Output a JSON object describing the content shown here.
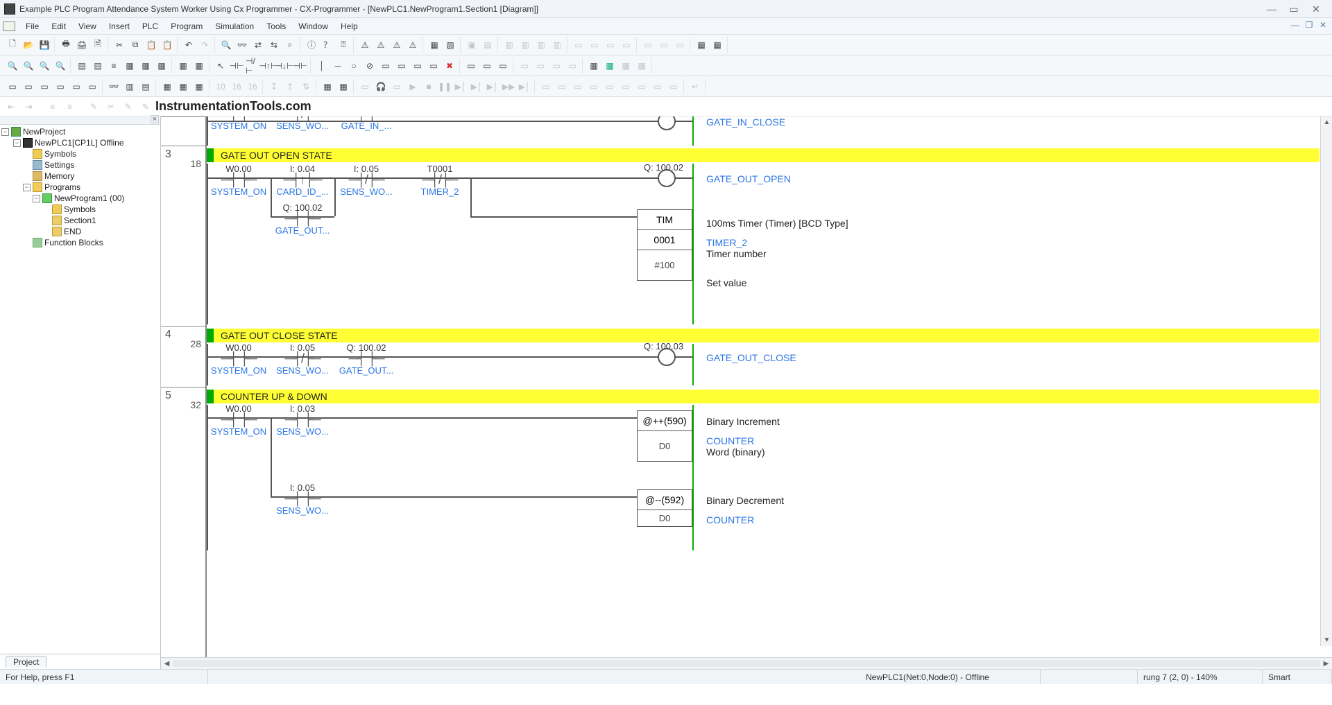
{
  "window": {
    "title": "Example PLC Program Attendance System Worker Using Cx Programmer - CX-Programmer - [NewPLC1.NewProgram1.Section1 [Diagram]]"
  },
  "menu": {
    "items": [
      "File",
      "Edit",
      "View",
      "Insert",
      "PLC",
      "Program",
      "Simulation",
      "Tools",
      "Window",
      "Help"
    ]
  },
  "watermark": "InstrumentationTools.com",
  "tree": {
    "root": "NewProject",
    "plc": "NewPLC1[CP1L] Offline",
    "symbols": "Symbols",
    "settings": "Settings",
    "memory": "Memory",
    "programs": "Programs",
    "newprog": "NewProgram1 (00)",
    "symbols2": "Symbols",
    "section1": "Section1",
    "end": "END",
    "fblocks": "Function Blocks",
    "tab": "Project"
  },
  "gutter": {
    "r3": "3",
    "r3s": "18",
    "r4": "4",
    "r4s": "28",
    "r5": "5",
    "r5s": "32"
  },
  "rungtop": {
    "c1_name": "SYSTEM_ON",
    "c2_name": "SENS_WO...",
    "c3_name": "GATE_IN_...",
    "out_name": "GATE_IN_CLOSE"
  },
  "rung3": {
    "comment": "GATE OUT OPEN STATE",
    "c1_addr": "W0.00",
    "c1_name": "SYSTEM_ON",
    "c2_addr": "I: 0.04",
    "c2_name": "CARD_ID_...",
    "c3_addr": "I: 0.05",
    "c3_name": "SENS_WO...",
    "c4_addr": "T0001",
    "c4_name": "TIMER_2",
    "b_addr": "Q: 100.02",
    "b_name": "GATE_OUT...",
    "out_addr": "Q: 100.02",
    "out_name": "GATE_OUT_OPEN",
    "tim_label": "TIM",
    "tim_num": "0001",
    "tim_set": "#100",
    "tim_desc": "100ms Timer (Timer) [BCD Type]",
    "tim_name": "TIMER_2",
    "tim_param": "Timer number",
    "tim_setlbl": "Set value"
  },
  "rung4": {
    "comment": "GATE OUT CLOSE STATE",
    "c1_addr": "W0.00",
    "c1_name": "SYSTEM_ON",
    "c2_addr": "I: 0.05",
    "c2_name": "SENS_WO...",
    "c3_addr": "Q: 100.02",
    "c3_name": "GATE_OUT...",
    "out_addr": "Q: 100.03",
    "out_name": "GATE_OUT_CLOSE"
  },
  "rung5": {
    "comment": "COUNTER UP & DOWN",
    "c1_addr": "W0.00",
    "c1_name": "SYSTEM_ON",
    "c2_addr": "I: 0.03",
    "c2_name": "SENS_WO...",
    "b2_addr": "I: 0.05",
    "b2_name": "SENS_WO...",
    "inc_op": "@++(590)",
    "inc_d": "D0",
    "inc_desc": "Binary Increment",
    "inc_name": "COUNTER",
    "inc_type": "Word (binary)",
    "dec_op": "@--(592)",
    "dec_d": "D0",
    "dec_desc": "Binary Decrement",
    "dec_name": "COUNTER"
  },
  "status": {
    "help": "For Help, press F1",
    "conn": "NewPLC1(Net:0,Node:0) - Offline",
    "pos": "rung 7 (2, 0)  - 140%",
    "mode": "Smart"
  }
}
